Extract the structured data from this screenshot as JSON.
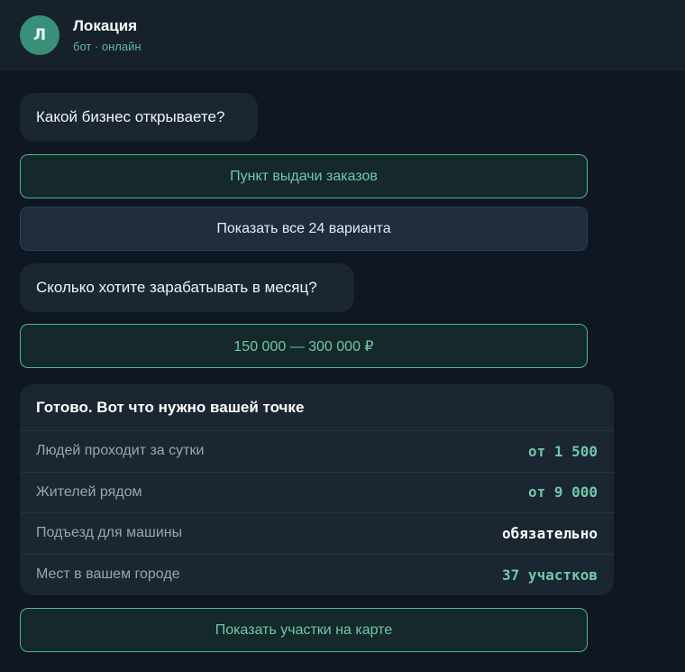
{
  "header": {
    "avatar_letter": "Л",
    "title": "Локация",
    "status": "бот · онлайн"
  },
  "chat": {
    "question_1": "Какой бизнес открываете?",
    "option_selected_1": "Пункт выдачи заказов",
    "option_show_all": "Показать все 24 варианта",
    "question_2": "Сколько хотите зарабатывать в месяц?",
    "option_selected_2": "150 000 — 300 000 ₽",
    "result": {
      "title": "Готово. Вот что нужно вашей точке",
      "rows": [
        {
          "label": "Людей проходит за сутки",
          "value": "от 1 500",
          "color": "#6fc7ab"
        },
        {
          "label": "Жителей рядом",
          "value": "от 9 000",
          "color": "#6fc7ab"
        },
        {
          "label": "Подъезд для машины",
          "value": "обязательно",
          "color": "#ffffff"
        },
        {
          "label": "Мест в вашем городе",
          "value": "37 участков",
          "color": "#6fc7ab"
        }
      ]
    },
    "map_button": "Показать участки на карте"
  },
  "colors": {
    "background": "#0f1722",
    "header": "#16212b",
    "accent": "#4fb394",
    "bubble": "#1a2631"
  }
}
